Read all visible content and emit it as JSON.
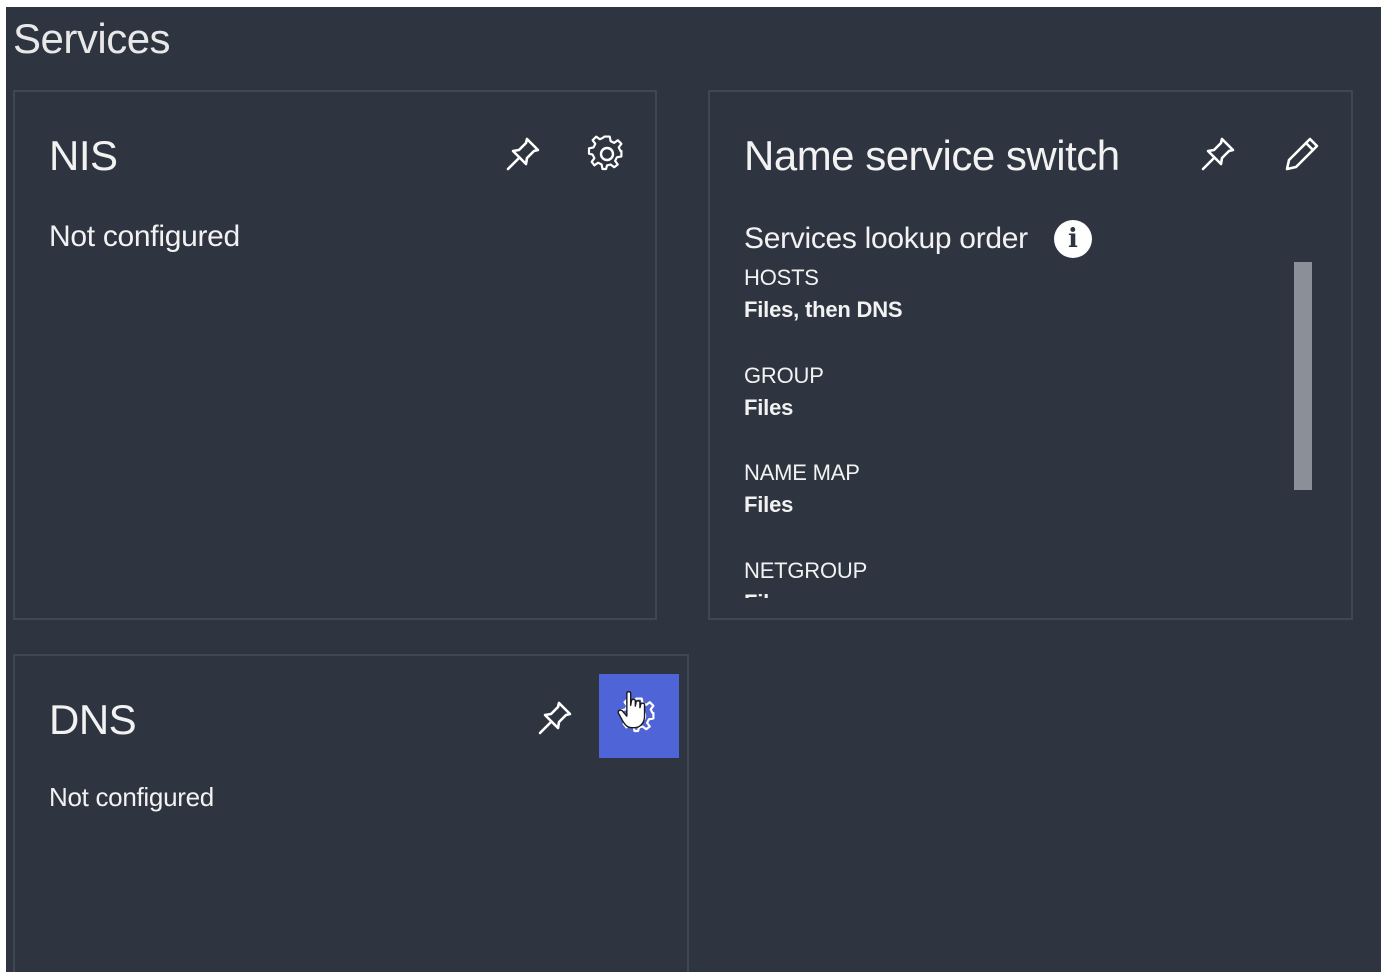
{
  "page": {
    "title": "Services"
  },
  "nis": {
    "title": "NIS",
    "status": "Not configured",
    "pin_icon": "pin-icon",
    "settings_icon": "gear-icon"
  },
  "name_service_switch": {
    "title": "Name service switch",
    "lookup_header": "Services lookup order",
    "info_glyph": "i",
    "pin_icon": "pin-icon",
    "edit_icon": "pencil-icon",
    "items": [
      {
        "name": "HOSTS",
        "value": "Files, then DNS"
      },
      {
        "name": "GROUP",
        "value": "Files"
      },
      {
        "name": "NAME MAP",
        "value": "Files"
      },
      {
        "name": "NETGROUP",
        "value": "Files"
      }
    ]
  },
  "dns": {
    "title": "DNS",
    "status": "Not configured",
    "pin_icon": "pin-icon",
    "settings_icon": "gear-icon"
  },
  "colors": {
    "background": "#2e3440",
    "card_border": "#3f4654",
    "active_button": "#4f64d6",
    "scrollbar_thumb": "#8a8f98"
  }
}
